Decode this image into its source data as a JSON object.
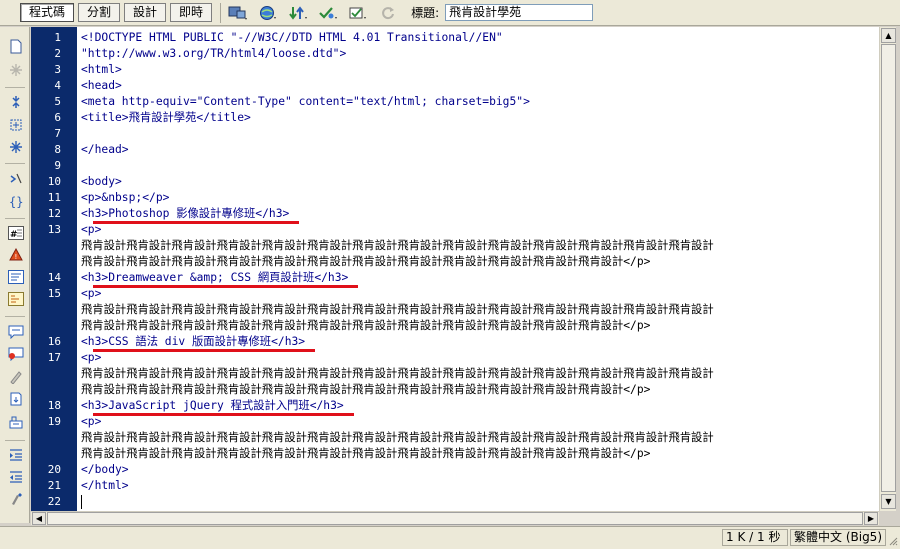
{
  "toolbar": {
    "views": [
      {
        "label": "程式碼",
        "active": true
      },
      {
        "label": "分割",
        "active": false
      },
      {
        "label": "設計",
        "active": false
      },
      {
        "label": "即時",
        "active": false
      }
    ],
    "icons": [
      "multiscreen-icon",
      "preview-browser-icon",
      "file-management-icon",
      "check-page-icon",
      "visual-aids-icon",
      "refresh-icon"
    ],
    "title_label": "標題:",
    "title_value": "飛肯設計學苑"
  },
  "left_tools": [
    "open-documents-icon",
    "show-code-navigator-icon",
    "collapse-full-tag-icon",
    "collapse-selection-icon",
    "expand-all-icon",
    "select-parent-tag-icon",
    "balance-braces-icon",
    "line-numbers-icon",
    "highlight-invalid-code-icon",
    "word-wrap-icon",
    "syntax-coloring-icon",
    "apply-comment-icon",
    "remove-comment-icon",
    "wrap-tag-icon",
    "recent-snippets-icon",
    "move-css-icon",
    "indent-code-icon",
    "outdent-code-icon",
    "format-source-icon"
  ],
  "editor": {
    "line_numbers": [
      "1",
      "2",
      "3",
      "4",
      "5",
      "6",
      "7",
      "8",
      "9",
      "10",
      "11",
      "12",
      "13",
      "",
      "",
      "14",
      "15",
      "",
      "",
      "16",
      "17",
      "",
      "",
      "18",
      "19",
      "",
      "",
      "20",
      "21",
      "22"
    ],
    "lines": [
      {
        "text": "<!DOCTYPE HTML PUBLIC \"-//W3C//DTD HTML 4.01 Transitional//EN\"",
        "kind": "tag"
      },
      {
        "text": "\"http://www.w3.org/TR/html4/loose.dtd\">",
        "kind": "tag"
      },
      {
        "text": "<html>",
        "kind": "tag"
      },
      {
        "text": "<head>",
        "kind": "tag"
      },
      {
        "text": "<meta http-equiv=\"Content-Type\" content=\"text/html; charset=big5\">",
        "kind": "tag"
      },
      {
        "text": "<title>飛肯設計學苑</title>",
        "kind": "tag"
      },
      {
        "text": "",
        "kind": "tag"
      },
      {
        "text": "</head>",
        "kind": "tag"
      },
      {
        "text": "",
        "kind": "tag"
      },
      {
        "text": "<body>",
        "kind": "tag"
      },
      {
        "text": "<p>&nbsp;</p>",
        "kind": "tag"
      },
      {
        "text": "  <h3>Photoshop 影像設計專修班</h3>",
        "kind": "tag"
      },
      {
        "text": "  <p>",
        "kind": "tag"
      },
      {
        "text": "飛肯設計飛肯設計飛肯設計飛肯設計飛肯設計飛肯設計飛肯設計飛肯設計飛肯設計飛肯設計飛肯設計飛肯設計飛肯設計飛肯設計",
        "kind": "text"
      },
      {
        "text": "飛肯設計飛肯設計飛肯設計飛肯設計飛肯設計飛肯設計飛肯設計飛肯設計飛肯設計飛肯設計飛肯設計飛肯設計</p>",
        "kind": "text"
      },
      {
        "text": "  <h3>Dreamweaver &amp; CSS 網頁設計班</h3>",
        "kind": "tag"
      },
      {
        "text": "  <p>",
        "kind": "tag"
      },
      {
        "text": "飛肯設計飛肯設計飛肯設計飛肯設計飛肯設計飛肯設計飛肯設計飛肯設計飛肯設計飛肯設計飛肯設計飛肯設計飛肯設計飛肯設計",
        "kind": "text"
      },
      {
        "text": "飛肯設計飛肯設計飛肯設計飛肯設計飛肯設計飛肯設計飛肯設計飛肯設計飛肯設計飛肯設計飛肯設計飛肯設計</p>",
        "kind": "text"
      },
      {
        "text": "  <h3>CSS 語法 div 版面設計專修班</h3>",
        "kind": "tag"
      },
      {
        "text": "  <p>",
        "kind": "tag"
      },
      {
        "text": "飛肯設計飛肯設計飛肯設計飛肯設計飛肯設計飛肯設計飛肯設計飛肯設計飛肯設計飛肯設計飛肯設計飛肯設計飛肯設計飛肯設計",
        "kind": "text"
      },
      {
        "text": "飛肯設計飛肯設計飛肯設計飛肯設計飛肯設計飛肯設計飛肯設計飛肯設計飛肯設計飛肯設計飛肯設計飛肯設計</p>",
        "kind": "text"
      },
      {
        "text": "  <h3>JavaScript jQuery 程式設計入門班</h3>",
        "kind": "tag"
      },
      {
        "text": "  <p>",
        "kind": "tag"
      },
      {
        "text": "飛肯設計飛肯設計飛肯設計飛肯設計飛肯設計飛肯設計飛肯設計飛肯設計飛肯設計飛肯設計飛肯設計飛肯設計飛肯設計飛肯設計",
        "kind": "text"
      },
      {
        "text": "飛肯設計飛肯設計飛肯設計飛肯設計飛肯設計飛肯設計飛肯設計飛肯設計飛肯設計飛肯設計飛肯設計飛肯設計</p>",
        "kind": "text"
      },
      {
        "text": "</body>",
        "kind": "tag"
      },
      {
        "text": "</html>",
        "kind": "tag"
      },
      {
        "text": "",
        "kind": "tag"
      }
    ],
    "underline_color": "#e0101a",
    "gutter_color": "#0b2a6b",
    "tag_color": "#00008b"
  },
  "status": {
    "size_time": "1 K / 1 秒",
    "encoding": "繁體中文 (Big5)"
  }
}
